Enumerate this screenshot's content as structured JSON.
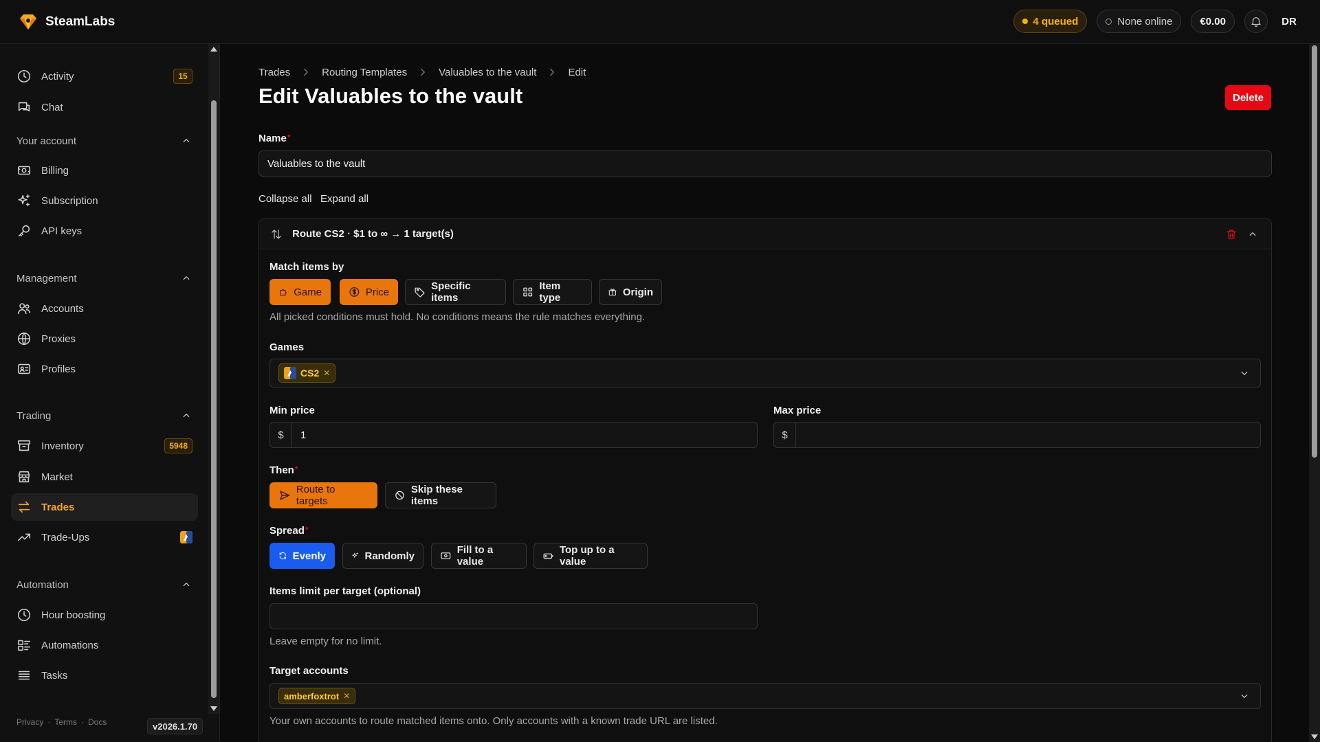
{
  "app": {
    "name": "SteamLabs"
  },
  "topbar": {
    "queued": "4 queued",
    "online": "None online",
    "balance": "€0.00",
    "avatar": "DR"
  },
  "sidebar": {
    "items_top": [
      {
        "label": "Activity",
        "icon": "clock-icon",
        "badge": "15"
      },
      {
        "label": "Chat",
        "icon": "chat-icon"
      }
    ],
    "sections": [
      {
        "title": "Your account",
        "items": [
          {
            "label": "Billing",
            "icon": "billing-icon"
          },
          {
            "label": "Subscription",
            "icon": "sparkle-icon"
          },
          {
            "label": "API keys",
            "icon": "key-icon"
          }
        ]
      },
      {
        "title": "Management",
        "items": [
          {
            "label": "Accounts",
            "icon": "users-icon"
          },
          {
            "label": "Proxies",
            "icon": "globe-icon"
          },
          {
            "label": "Profiles",
            "icon": "id-card-icon"
          }
        ]
      },
      {
        "title": "Trading",
        "items": [
          {
            "label": "Inventory",
            "icon": "archive-icon",
            "badge": "5948"
          },
          {
            "label": "Market",
            "icon": "store-icon"
          },
          {
            "label": "Trades",
            "icon": "arrows-icon",
            "active": true
          },
          {
            "label": "Trade-Ups",
            "icon": "trend-icon"
          }
        ]
      },
      {
        "title": "Automation",
        "items": [
          {
            "label": "Hour boosting",
            "icon": "clock-icon"
          },
          {
            "label": "Automations",
            "icon": "automation-icon"
          },
          {
            "label": "Tasks",
            "icon": "list-icon"
          }
        ]
      }
    ],
    "footer": {
      "privacy": "Privacy",
      "terms": "Terms",
      "docs": "Docs",
      "version": "v2026.1.70"
    }
  },
  "breadcrumb": [
    "Trades",
    "Routing Templates",
    "Valuables to the vault",
    "Edit"
  ],
  "page": {
    "title": "Edit Valuables to the vault",
    "delete": "Delete",
    "name_label": "Name",
    "name_value": "Valuables to the vault",
    "collapse_all": "Collapse all",
    "expand_all": "Expand all"
  },
  "route": {
    "title": "Route CS2 · $1 to ∞ → 1 target(s)",
    "match_label": "Match items by",
    "match_chips": [
      {
        "label": "Game",
        "selected": true
      },
      {
        "label": "Price",
        "selected": true
      },
      {
        "label": "Specific items",
        "selected": false
      },
      {
        "label": "Item type",
        "selected": false
      },
      {
        "label": "Origin",
        "selected": false
      }
    ],
    "match_hint": "All picked conditions must hold. No conditions means the rule matches everything.",
    "games_label": "Games",
    "games": [
      "CS2"
    ],
    "min_price_label": "Min price",
    "min_price": "1",
    "max_price_label": "Max price",
    "max_price": "",
    "currency": "$",
    "then_label": "Then",
    "then_options": [
      {
        "label": "Route to targets",
        "selected": true
      },
      {
        "label": "Skip these items",
        "selected": false
      }
    ],
    "spread_label": "Spread",
    "spread_options": [
      {
        "label": "Evenly",
        "selected": true
      },
      {
        "label": "Randomly",
        "selected": false
      },
      {
        "label": "Fill to a value",
        "selected": false
      },
      {
        "label": "Top up to a value",
        "selected": false
      }
    ],
    "limit_label": "Items limit per target (optional)",
    "limit_value": "",
    "limit_hint": "Leave empty for no limit.",
    "targets_label": "Target accounts",
    "targets": [
      "amberfoxtrot"
    ],
    "targets_hint": "Your own accounts to route matched items onto. Only accounts with a known trade URL are listed."
  },
  "colors": {
    "accent_orange": "#e8760c",
    "accent_blue": "#1a5cf0",
    "danger": "#e50914",
    "badge_yellow": "#f5b400"
  }
}
